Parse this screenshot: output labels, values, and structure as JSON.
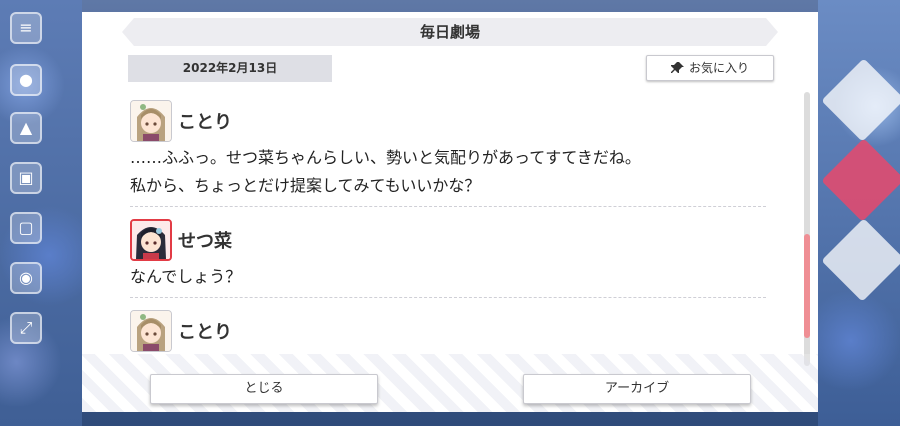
{
  "modal": {
    "title": "毎日劇場",
    "date": "2022年2月13日",
    "favorite_label": "お気に入り"
  },
  "messages": [
    {
      "speaker": "ことり",
      "avatar_icon": "kotori-avatar-icon",
      "lines": [
        "……ふふっ。せつ菜ちゃんらしい、勢いと気配りがあってすてきだね。",
        "私から、ちょっとだけ提案してみてもいいかな？"
      ]
    },
    {
      "speaker": "せつ菜",
      "avatar_icon": "setsuna-avatar-icon",
      "lines": [
        "なんでしょう？"
      ]
    },
    {
      "speaker": "ことり",
      "avatar_icon": "kotori-avatar-icon",
      "lines": []
    }
  ],
  "buttons": {
    "close_label": "とじる",
    "archive_label": "アーカイブ"
  },
  "colors": {
    "scroll_thumb": "#ef8e94",
    "accent_red": "#e23b45"
  },
  "scroll": {
    "position_fraction": 0.53
  }
}
